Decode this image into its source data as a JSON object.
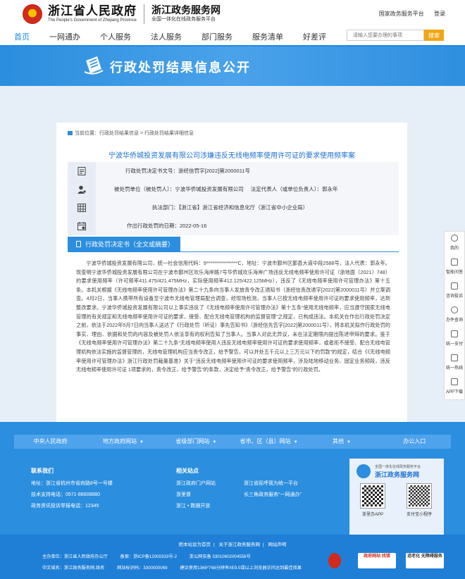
{
  "header": {
    "gov_name": "浙江省人民政府",
    "gov_name_en": "The People's Government of Zhejiang Province",
    "service_name": "浙江政务服务网",
    "service_sub": "全国一体化在线政务服务平台",
    "top_links": [
      "国家政务服务平台",
      "登录"
    ]
  },
  "nav": {
    "items": [
      "首页",
      "一网通办",
      "个人服务",
      "法人服务",
      "部门服务",
      "服务清单",
      "好差评"
    ],
    "active_index": 0,
    "search_placeholder": "请输入您要办理的事项",
    "search_button": "搜索"
  },
  "banner": {
    "title": "行政处罚结果信息公开"
  },
  "breadcrumb": "当前位置：行政处罚结果信息 > 行政处罚结果详细信息",
  "doc_title": "宁波华侨城投资发展有限公司涉嫌违反无线电频率使用许可证的要求使用频率案",
  "info": {
    "doc_no_label": "行政处罚决定书文号：",
    "doc_no": "浙经信罚字[2022]第2000011号",
    "party_label": "被处罚单位（被处罚人）：",
    "party": "宁波华侨城投资发展有限公司",
    "legal_label": "法定代表人（或单位负责人）：",
    "legal": "郭永年",
    "agency_label": "执法部门：",
    "agency": "【浙江省】浙江省经济和信息化厅（浙江省中小企业局）",
    "date_label": "作出行政处罚的日期：",
    "date": "2022-05-16"
  },
  "decision": {
    "tab": "行政处罚决定书（全文或摘要）",
    "body": "宁波华侨城投资发展有限公司，统一社会信用代码：9****************C，地址：宁波市鄞州区鄞县大道中段2588号，法人代表：郭永年。现查明宁波华侨城投资发展有限公司在宁波市鄞州区欢乐海岸路7号华侨城欢乐海岸广场违反无线电频率使用许可证（浙地面〔2021〕748）的要求使用频率（许可频率411.475/421.475MHz，实际使用频率412.125/422.125MHz），违反了《无线电频率使用许可管理办法》第十五条。本机关根据《无线电频率使用许可管理办法》第二十九条向当事人发放责令改正通知书（浙经信责改通字[2022]第2000011号）并立案调查。4月2日，当事人携带所有设备至宁波市无线电管理局配合调查，经现场检测，当事人已按无线电频率使用许可证的要求使用频率，达到整改要求。宁波华侨城投资发展有限公司以上事实违反了《无线电频率使用许可管理办法》第十五条“使用无线电频率，应当遵守国家无线电管理的有关规定和无线电频率使用许可证的要求，接受、配合无线电管理机构的监督管理”之规定，已构成违法。本机关在作出行政处罚决定之前，依法于2022年5月7日向当事人送达了《行政处罚（听证）事先告知书》（浙经信先告字[2022]第2000011号），将本机关拟作行政处罚的事实、理由、依据和处罚的内容及被处罚人依法享有的权利告知了当事人。当事人对此无异议，未在法定期限内提出陈述申辩的要求。鉴于《无线电频率使用许可管理办法》第二十九条“无线电频率使用人违反无线电频率使用许可证的要求使用频率，或者拒不接受、配合无线电管理机构依法实施的监督管理的，无线电管理机构应当责令改正，给予警告，可以并处五千元以上三万元以下的罚款”的规定，结合《《无线电频率使用许可管理办法》浙江行政处罚裁量基准》关于“违反无线电频率使用许可证的要求使用频率，涉及陆地移动业务、固定业务频段，违反无线电频率使用许可证 1项要求的，责令改正，给予警告”的条款，决定给予“责令改正，给予警告”的行政处罚。"
  },
  "side_widget": [
    "我的",
    "智能问答",
    "咨询投诉",
    "办件查询",
    "统一支付",
    "统一热线",
    "APP下载"
  ],
  "footer": {
    "links": [
      "中央人民政府",
      "地方政府网站",
      "省级部门网站",
      "省市、区（县）网站",
      "其他",
      "办公入口"
    ],
    "contact_title": "联系我们",
    "contact": [
      "地址：浙江省杭州市省府路8号一号楼",
      "技术支持电话：0571-88808880",
      "政务资讯投诉举报电话：12345"
    ],
    "related_title": "相关站点",
    "related_col1": [
      "浙江政府门户网站",
      "浙里督",
      "浙江 • 数据开放"
    ],
    "related_col2": [
      "浙江省民呼我为统一平台",
      "长三角政务服务“一网通办”"
    ],
    "app_sub": "全国一体化在线政务服务平台",
    "app_name": "浙江政务服务网",
    "qr_captions": [
      "浙里办APP",
      "支付宝小程序"
    ],
    "bottom_links": [
      "把本站设为首页",
      "关于浙江政务服务网",
      "网站声明"
    ],
    "row1": [
      "主办单位：浙江省人民政府办公厅",
      "备案：浙ICP备12000333号-2",
      "浙公网安备 33010602004556号"
    ],
    "row2": [
      "中文域名：浙江政务服务网.政务",
      "网站标识码：3300000069",
      "建议使用1366*768分辨率/IE9.0或以上浏览器访问达到最佳效果"
    ],
    "badge_2": "政府网站 找错",
    "badge_3": "适老化 无障碍服务"
  }
}
